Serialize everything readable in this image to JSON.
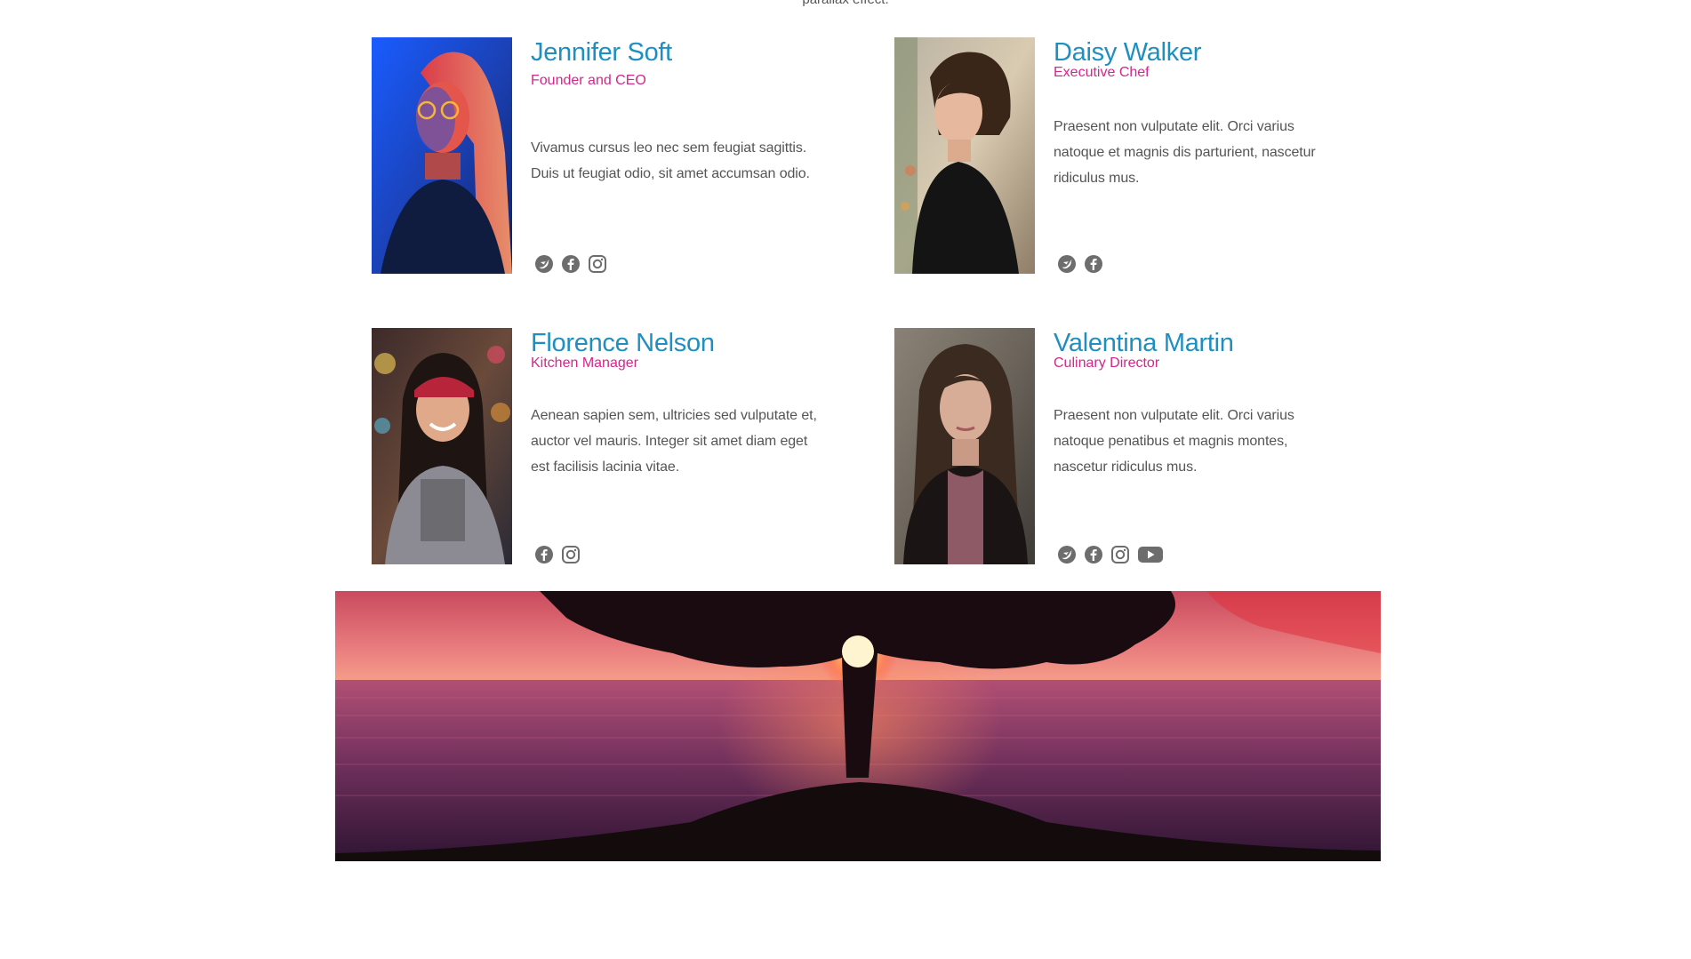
{
  "page": {
    "top_fragment": "parallax effect."
  },
  "colors": {
    "name": "#1f8fc1",
    "role": "#d2278b",
    "text": "#555555",
    "icon": "#6d6d6d"
  },
  "team": [
    {
      "name": "Jennifer Soft",
      "role": "Founder and CEO",
      "bio": "Vivamus cursus leo nec sem feugiat sagittis. Duis ut feugiat odio, sit amet accumsan odio.",
      "photo_alt": "Portrait of Jennifer Soft",
      "socials": [
        "twitter-icon",
        "facebook-icon",
        "instagram-icon"
      ]
    },
    {
      "name": "Daisy Walker",
      "role": "Executive Chef",
      "bio": "Praesent non vulputate elit. Orci varius natoque et magnis dis parturient, nascetur ridiculus mus.",
      "photo_alt": "Portrait of Daisy Walker",
      "socials": [
        "twitter-icon",
        "facebook-icon"
      ]
    },
    {
      "name": "Florence Nelson",
      "role": "Kitchen Manager",
      "bio": "Aenean sapien sem, ultricies sed vulputate et, auctor vel mauris. Integer sit amet diam eget est facilisis lacinia vitae.",
      "photo_alt": "Portrait of Florence Nelson",
      "socials": [
        "facebook-icon",
        "instagram-icon"
      ]
    },
    {
      "name": "Valentina Martin",
      "role": "Culinary Director",
      "bio": "Praesent non vulputate elit. Orci varius natoque penatibus et magnis montes, nascetur ridiculus mus.",
      "photo_alt": "Portrait of Valentina Martin",
      "socials": [
        "twitter-icon",
        "facebook-icon",
        "instagram-icon",
        "youtube-icon"
      ]
    }
  ],
  "banner": {
    "alt": "Tree silhouette at sunset over the sea"
  }
}
